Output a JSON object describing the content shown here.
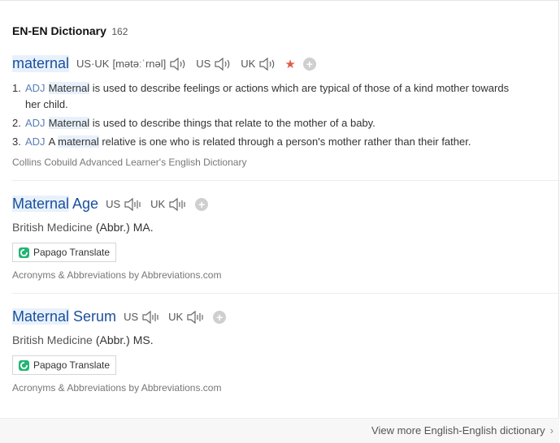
{
  "header": {
    "title": "EN-EN Dictionary",
    "count": "162"
  },
  "entry1": {
    "word": "maternal",
    "pron_us_uk_label": "US·UK",
    "ipa": "[mətəːˈrnəl]",
    "us_label": "US",
    "uk_label": "UK",
    "star_icon": "star-icon",
    "definitions": [
      {
        "num": "1.",
        "pos": "ADJ",
        "hl": "Maternal",
        "rest": " is used to describe feelings or actions which are typical of those of a kind mother towards",
        "cont": "her child."
      },
      {
        "num": "2.",
        "pos": "ADJ",
        "hl": "Maternal",
        "rest": " is used to describe things that relate to the mother of a baby."
      },
      {
        "num": "3.",
        "pos": "ADJ",
        "pre": "A ",
        "hl": "maternal",
        "rest": " relative is one who is related through a person's mother rather than their father."
      }
    ],
    "source": "Collins Cobuild Advanced Learner's English Dictionary"
  },
  "entry2": {
    "word_hl": "Maternal",
    "word_rest": " Age",
    "us_label": "US",
    "uk_label": "UK",
    "domain": "British Medicine",
    "abbr": "(Abbr.) MA.",
    "papago": "Papago Translate",
    "source": "Acronyms & Abbreviations by Abbreviations.com"
  },
  "entry3": {
    "word_hl": "Maternal",
    "word_rest": " Serum",
    "us_label": "US",
    "uk_label": "UK",
    "domain": "British Medicine",
    "abbr": "(Abbr.) MS.",
    "papago": "Papago Translate",
    "source": "Acronyms & Abbreviations by Abbreviations.com"
  },
  "footer": {
    "more_label": "View more English-English dictionary",
    "chevron": "›"
  },
  "colors": {
    "link": "#1a4f9c",
    "pos": "#5a7fb8",
    "star": "#e05a4a",
    "highlight": "#e8f1fb"
  }
}
